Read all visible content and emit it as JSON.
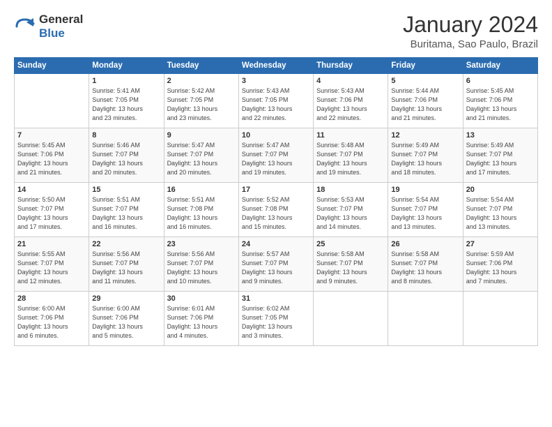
{
  "header": {
    "logo_line1": "General",
    "logo_line2": "Blue",
    "month_year": "January 2024",
    "location": "Buritama, Sao Paulo, Brazil"
  },
  "calendar": {
    "days_of_week": [
      "Sunday",
      "Monday",
      "Tuesday",
      "Wednesday",
      "Thursday",
      "Friday",
      "Saturday"
    ],
    "weeks": [
      [
        {
          "day": "",
          "info": ""
        },
        {
          "day": "1",
          "info": "Sunrise: 5:41 AM\nSunset: 7:05 PM\nDaylight: 13 hours\nand 23 minutes."
        },
        {
          "day": "2",
          "info": "Sunrise: 5:42 AM\nSunset: 7:05 PM\nDaylight: 13 hours\nand 23 minutes."
        },
        {
          "day": "3",
          "info": "Sunrise: 5:43 AM\nSunset: 7:05 PM\nDaylight: 13 hours\nand 22 minutes."
        },
        {
          "day": "4",
          "info": "Sunrise: 5:43 AM\nSunset: 7:06 PM\nDaylight: 13 hours\nand 22 minutes."
        },
        {
          "day": "5",
          "info": "Sunrise: 5:44 AM\nSunset: 7:06 PM\nDaylight: 13 hours\nand 21 minutes."
        },
        {
          "day": "6",
          "info": "Sunrise: 5:45 AM\nSunset: 7:06 PM\nDaylight: 13 hours\nand 21 minutes."
        }
      ],
      [
        {
          "day": "7",
          "info": "Sunrise: 5:45 AM\nSunset: 7:06 PM\nDaylight: 13 hours\nand 21 minutes."
        },
        {
          "day": "8",
          "info": "Sunrise: 5:46 AM\nSunset: 7:07 PM\nDaylight: 13 hours\nand 20 minutes."
        },
        {
          "day": "9",
          "info": "Sunrise: 5:47 AM\nSunset: 7:07 PM\nDaylight: 13 hours\nand 20 minutes."
        },
        {
          "day": "10",
          "info": "Sunrise: 5:47 AM\nSunset: 7:07 PM\nDaylight: 13 hours\nand 19 minutes."
        },
        {
          "day": "11",
          "info": "Sunrise: 5:48 AM\nSunset: 7:07 PM\nDaylight: 13 hours\nand 19 minutes."
        },
        {
          "day": "12",
          "info": "Sunrise: 5:49 AM\nSunset: 7:07 PM\nDaylight: 13 hours\nand 18 minutes."
        },
        {
          "day": "13",
          "info": "Sunrise: 5:49 AM\nSunset: 7:07 PM\nDaylight: 13 hours\nand 17 minutes."
        }
      ],
      [
        {
          "day": "14",
          "info": "Sunrise: 5:50 AM\nSunset: 7:07 PM\nDaylight: 13 hours\nand 17 minutes."
        },
        {
          "day": "15",
          "info": "Sunrise: 5:51 AM\nSunset: 7:07 PM\nDaylight: 13 hours\nand 16 minutes."
        },
        {
          "day": "16",
          "info": "Sunrise: 5:51 AM\nSunset: 7:08 PM\nDaylight: 13 hours\nand 16 minutes."
        },
        {
          "day": "17",
          "info": "Sunrise: 5:52 AM\nSunset: 7:08 PM\nDaylight: 13 hours\nand 15 minutes."
        },
        {
          "day": "18",
          "info": "Sunrise: 5:53 AM\nSunset: 7:07 PM\nDaylight: 13 hours\nand 14 minutes."
        },
        {
          "day": "19",
          "info": "Sunrise: 5:54 AM\nSunset: 7:07 PM\nDaylight: 13 hours\nand 13 minutes."
        },
        {
          "day": "20",
          "info": "Sunrise: 5:54 AM\nSunset: 7:07 PM\nDaylight: 13 hours\nand 13 minutes."
        }
      ],
      [
        {
          "day": "21",
          "info": "Sunrise: 5:55 AM\nSunset: 7:07 PM\nDaylight: 13 hours\nand 12 minutes."
        },
        {
          "day": "22",
          "info": "Sunrise: 5:56 AM\nSunset: 7:07 PM\nDaylight: 13 hours\nand 11 minutes."
        },
        {
          "day": "23",
          "info": "Sunrise: 5:56 AM\nSunset: 7:07 PM\nDaylight: 13 hours\nand 10 minutes."
        },
        {
          "day": "24",
          "info": "Sunrise: 5:57 AM\nSunset: 7:07 PM\nDaylight: 13 hours\nand 9 minutes."
        },
        {
          "day": "25",
          "info": "Sunrise: 5:58 AM\nSunset: 7:07 PM\nDaylight: 13 hours\nand 9 minutes."
        },
        {
          "day": "26",
          "info": "Sunrise: 5:58 AM\nSunset: 7:07 PM\nDaylight: 13 hours\nand 8 minutes."
        },
        {
          "day": "27",
          "info": "Sunrise: 5:59 AM\nSunset: 7:06 PM\nDaylight: 13 hours\nand 7 minutes."
        }
      ],
      [
        {
          "day": "28",
          "info": "Sunrise: 6:00 AM\nSunset: 7:06 PM\nDaylight: 13 hours\nand 6 minutes."
        },
        {
          "day": "29",
          "info": "Sunrise: 6:00 AM\nSunset: 7:06 PM\nDaylight: 13 hours\nand 5 minutes."
        },
        {
          "day": "30",
          "info": "Sunrise: 6:01 AM\nSunset: 7:06 PM\nDaylight: 13 hours\nand 4 minutes."
        },
        {
          "day": "31",
          "info": "Sunrise: 6:02 AM\nSunset: 7:05 PM\nDaylight: 13 hours\nand 3 minutes."
        },
        {
          "day": "",
          "info": ""
        },
        {
          "day": "",
          "info": ""
        },
        {
          "day": "",
          "info": ""
        }
      ]
    ]
  }
}
